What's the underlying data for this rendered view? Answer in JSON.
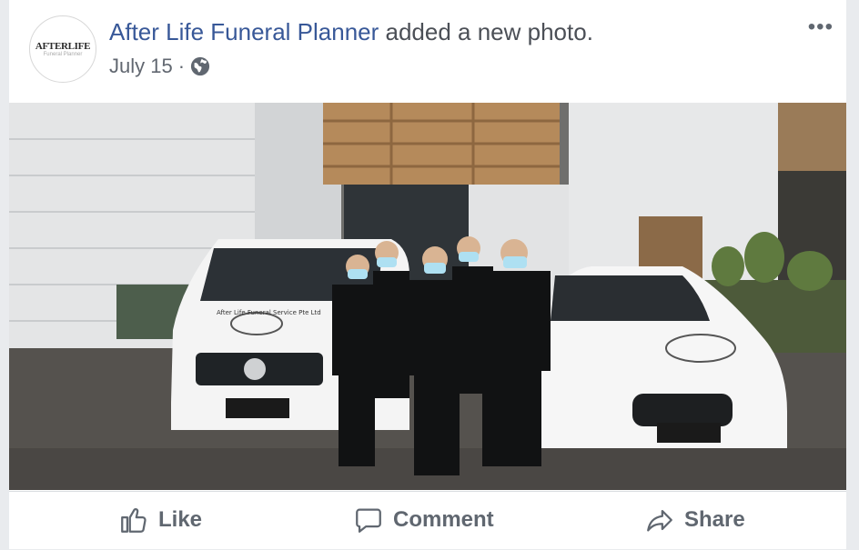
{
  "post": {
    "page_name": "After Life Funeral Planner",
    "action_text": " added a new photo.",
    "date": "July 15",
    "separator": " ·",
    "privacy_icon": "globe-icon",
    "more_icon": "more-options-icon",
    "more_glyph": "•••"
  },
  "avatar": {
    "logo_text": "AFTERLIFE",
    "logo_sub": "Funeral Planner"
  },
  "photo": {
    "van_text": "After Life Funeral Service Pte Ltd"
  },
  "actions": {
    "like_label": "Like",
    "comment_label": "Comment",
    "share_label": "Share"
  },
  "colors": {
    "link": "#385898",
    "text_secondary": "#606770",
    "divider": "#dadde1"
  }
}
